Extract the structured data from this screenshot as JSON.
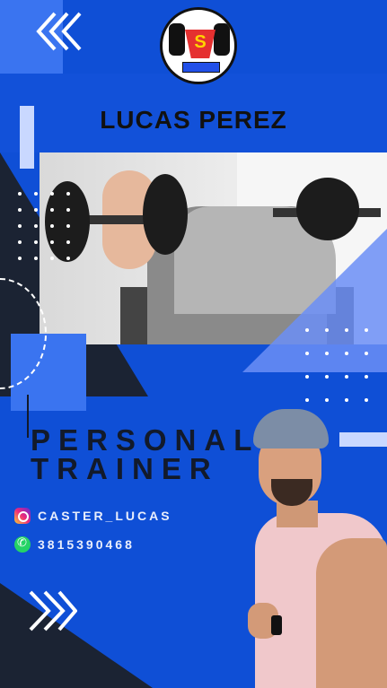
{
  "profile": {
    "name": "LUCAS PEREZ",
    "title_line1": "PERSONAL",
    "title_line2": "TRAINER"
  },
  "contacts": [
    {
      "icon": "instagram-icon",
      "text": "CASTER_LUCAS"
    },
    {
      "icon": "whatsapp-icon",
      "text": "3815390468"
    }
  ],
  "icons": {
    "top_left": "double-chevron-down-icon",
    "bottom_left": "double-chevron-right-icon",
    "logo": "superman-dumbbell-logo"
  },
  "colors": {
    "background": "#0f4fd6",
    "accent_light": "#3a74f0",
    "dark": "#1b2333",
    "title_text": "#121a2b"
  }
}
